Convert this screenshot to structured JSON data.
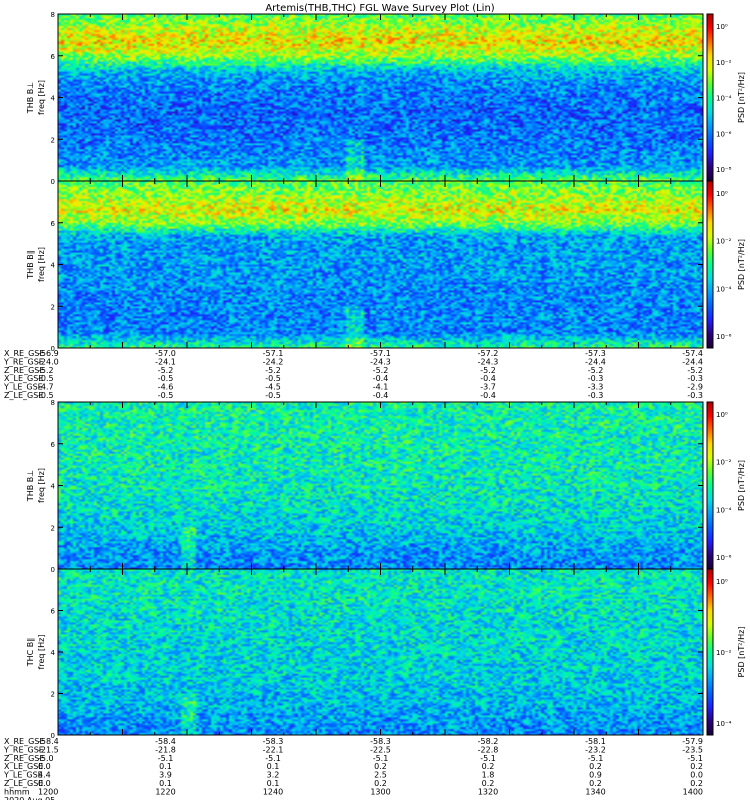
{
  "title": "Artemis(THB,THC) FGL Wave Survey Plot (Lin)",
  "colors": {
    "colormap": [
      "#1a0033",
      "#2b007f",
      "#1f1fff",
      "#0060ff",
      "#00a0ff",
      "#00e0e0",
      "#00ff90",
      "#60ff30",
      "#d8ff00",
      "#ffd800",
      "#ff6a00",
      "#ff0000",
      "#b00000"
    ]
  },
  "chart_data": [
    {
      "type": "heatmap",
      "probe_label": "THB B⊥",
      "ylabel": "freq [Hz]",
      "yticks": [
        "0",
        "2",
        "4",
        "6",
        "8"
      ],
      "ylim": [
        0,
        8
      ],
      "colorbar_label": "PSD [nT²/Hz]",
      "colorbar_ticks": [
        "10⁻⁸",
        "10⁻⁶",
        "10⁻⁴",
        "10⁻²",
        "10⁰"
      ],
      "band_profile": [
        0.55,
        0.32,
        0.3,
        0.28,
        0.27,
        0.26,
        0.28,
        0.3,
        0.38,
        0.62,
        0.72,
        0.66,
        0.55
      ],
      "quiet_time": 1292,
      "seed": 11
    },
    {
      "type": "heatmap",
      "probe_label": "THB B∥",
      "ylabel": "freq [Hz]",
      "yticks": [
        "0",
        "2",
        "4",
        "6"
      ],
      "ylim": [
        0,
        8
      ],
      "colorbar_label": "PSD [nT²/Hz]",
      "colorbar_ticks": [
        "10⁻⁶",
        "10⁻⁴",
        "10⁻²",
        "10⁰"
      ],
      "band_profile": [
        0.5,
        0.3,
        0.3,
        0.3,
        0.3,
        0.32,
        0.33,
        0.33,
        0.34,
        0.6,
        0.7,
        0.62,
        0.55
      ],
      "quiet_time": 1292,
      "seed": 23
    },
    {
      "type": "heatmap",
      "probe_label": "THB B⊥",
      "ylabel": "freq [Hz]",
      "yticks": [
        "0",
        "2",
        "4",
        "6",
        "8"
      ],
      "ylim": [
        0,
        8
      ],
      "colorbar_label": "PSD [nT²/Hz]",
      "colorbar_ticks": [
        "10⁻⁶",
        "10⁻⁴",
        "10⁻²",
        "10⁰"
      ],
      "band_profile": [
        0.3,
        0.32,
        0.36,
        0.4,
        0.42,
        0.44,
        0.45,
        0.46,
        0.46,
        0.46,
        0.47,
        0.47,
        0.47
      ],
      "quiet_time": 1240,
      "seed": 37
    },
    {
      "type": "heatmap",
      "probe_label": "THC B∥",
      "ylabel": "freq [Hz]",
      "yticks": [
        "0",
        "2",
        "4",
        "6"
      ],
      "ylim": [
        0,
        8
      ],
      "colorbar_label": "PSD [nT²/Hz]",
      "colorbar_ticks": [
        "10⁻⁴",
        "10⁻²",
        "10⁰"
      ],
      "band_profile": [
        0.3,
        0.33,
        0.36,
        0.38,
        0.4,
        0.4,
        0.41,
        0.42,
        0.42,
        0.43,
        0.44,
        0.44,
        0.44
      ],
      "quiet_time": 1240,
      "seed": 51
    }
  ],
  "ephemeris_top": {
    "labels": [
      "X_RE_GSE",
      "Y_RE_GSE",
      "Z_RE_GSE",
      "X_LE_GSE",
      "Y_LE_GSE",
      "Z_LE_GSE"
    ],
    "columns": [
      [
        "-56.9",
        "-24.0",
        "-5.2",
        "-0.5",
        "-4.7",
        "-0.5"
      ],
      [
        "-57.0",
        "-24.1",
        "-5.2",
        "-0.5",
        "-4.6",
        "-0.5"
      ],
      [
        "-57.1",
        "-24.2",
        "-5.2",
        "-0.5",
        "-4.5",
        "-0.5"
      ],
      [
        "-57.1",
        "-24.3",
        "-5.2",
        "-0.4",
        "-4.1",
        "-0.4"
      ],
      [
        "-57.2",
        "-24.3",
        "-5.2",
        "-0.4",
        "-3.7",
        "-0.4"
      ],
      [
        "-57.3",
        "-24.4",
        "-5.2",
        "-0.3",
        "-3.3",
        "-0.3"
      ],
      [
        "-57.4",
        "-24.4",
        "-5.2",
        "-0.3",
        "-2.9",
        "-0.3"
      ]
    ]
  },
  "ephemeris_bottom": {
    "labels": [
      "X_RE_GSE",
      "Y_RE_GSE",
      "Z_RE_GSE",
      "X_LE_GSE",
      "Y_LE_GSE",
      "Z_LE_GSE",
      "hhmm",
      "2020 Aug 05"
    ],
    "columns": [
      [
        "-58.4",
        "-21.5",
        "-5.0",
        "0.0",
        "4.4",
        "0.0",
        "1200"
      ],
      [
        "-58.4",
        "-21.8",
        "-5.1",
        "0.1",
        "3.9",
        "0.1",
        "1220"
      ],
      [
        "-58.3",
        "-22.1",
        "-5.1",
        "0.1",
        "3.2",
        "0.1",
        "1240"
      ],
      [
        "-58.3",
        "-22.5",
        "-5.1",
        "0.2",
        "2.5",
        "0.2",
        "1300"
      ],
      [
        "-58.2",
        "-22.8",
        "-5.1",
        "0.2",
        "1.8",
        "0.2",
        "1320"
      ],
      [
        "-58.1",
        "-23.2",
        "-5.1",
        "0.2",
        "0.9",
        "0.2",
        "1340"
      ],
      [
        "-57.9",
        "-23.5",
        "-5.1",
        "0.2",
        "0.0",
        "0.2",
        "1400"
      ]
    ]
  },
  "x_axis": {
    "label": "hhmm",
    "date": "2020 Aug 05",
    "xlim": [
      1200,
      1400
    ]
  }
}
